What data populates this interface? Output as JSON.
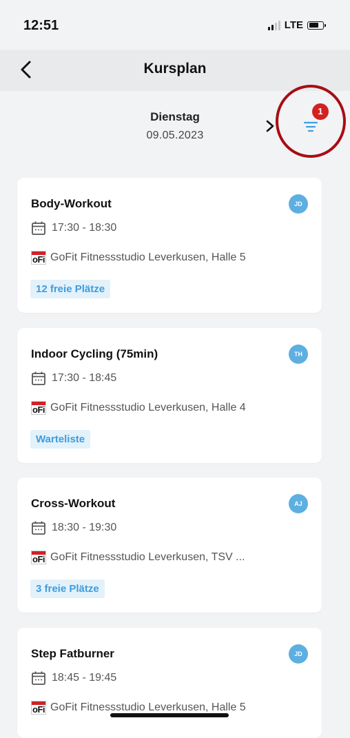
{
  "status": {
    "time": "12:51",
    "network": "LTE"
  },
  "nav": {
    "title": "Kursplan"
  },
  "date": {
    "day": "Dienstag",
    "date": "09.05.2023"
  },
  "filter": {
    "badge_count": "1"
  },
  "courses": [
    {
      "title": "Body-Workout",
      "initials": "JD",
      "time": "17:30 - 18:30",
      "location": "GoFit Fitnessstudio Leverkusen, Halle 5",
      "status": "12 freie Plätze"
    },
    {
      "title": "Indoor Cycling (75min)",
      "initials": "TH",
      "time": "17:30 - 18:45",
      "location": "GoFit Fitnessstudio Leverkusen, Halle 4",
      "status": "Warteliste"
    },
    {
      "title": "Cross-Workout",
      "initials": "AJ",
      "time": "18:30 - 19:30",
      "location": "GoFit Fitnessstudio Leverkusen, TSV ...",
      "status": "3 freie Plätze"
    },
    {
      "title": "Step Fatburner",
      "initials": "JD",
      "time": "18:45 - 19:45",
      "location": "GoFit Fitnessstudio Leverkusen, Halle 5"
    }
  ],
  "logo_text": "oFi",
  "colors": {
    "accent": "#3e9ddd",
    "badge_bg": "#e3f1fb",
    "notification": "#d52020",
    "highlight": "#a80d14",
    "avatar": "#5dafe1"
  }
}
